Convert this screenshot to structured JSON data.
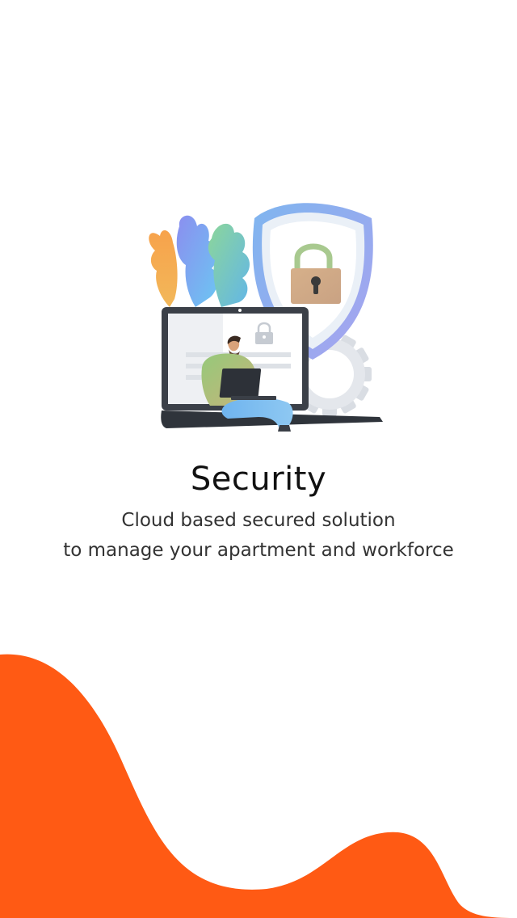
{
  "screen": {
    "title": "Security",
    "subtitle_line1": "Cloud based secured solution",
    "subtitle_line2": "to manage your apartment and workforce"
  },
  "illustration": {
    "name": "security-illustration",
    "elements": [
      "shield-icon",
      "padlock-icon",
      "laptop-icon",
      "gear-icon",
      "person-figure",
      "leaf-decoration"
    ]
  },
  "colors": {
    "accent": "#FF5A14",
    "background": "#FFFFFF",
    "title_text": "#111111",
    "subtitle_text": "#333333"
  }
}
